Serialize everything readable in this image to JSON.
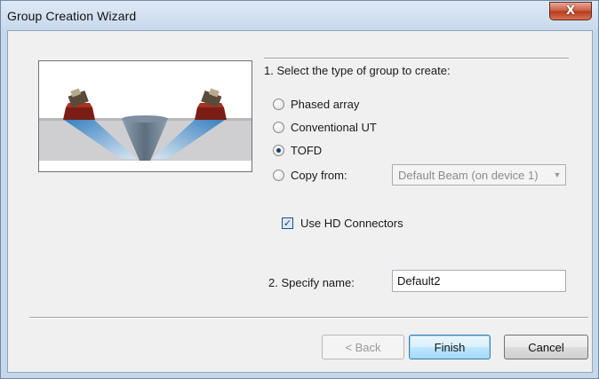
{
  "window": {
    "title": "Group Creation Wizard",
    "close_glyph": "X"
  },
  "step1": {
    "label": "1. Select the type of group to create:",
    "options": [
      {
        "label": "Phased array",
        "checked": false
      },
      {
        "label": "Conventional UT",
        "checked": false
      },
      {
        "label": "TOFD",
        "checked": true
      },
      {
        "label": "Copy from:",
        "checked": false
      }
    ],
    "copy_from_value": "Default Beam (on device 1)",
    "use_hd_connectors": {
      "label": "Use HD Connectors",
      "checked": true
    }
  },
  "step2": {
    "label": "2. Specify name:",
    "name_value": "Default2"
  },
  "buttons": {
    "back": "< Back",
    "finish": "Finish",
    "cancel": "Cancel"
  },
  "preview": {
    "icon": "tofd-probe-setup-illustration",
    "beam_color": "#3b86c4",
    "part_color": "#cfcfd1"
  }
}
